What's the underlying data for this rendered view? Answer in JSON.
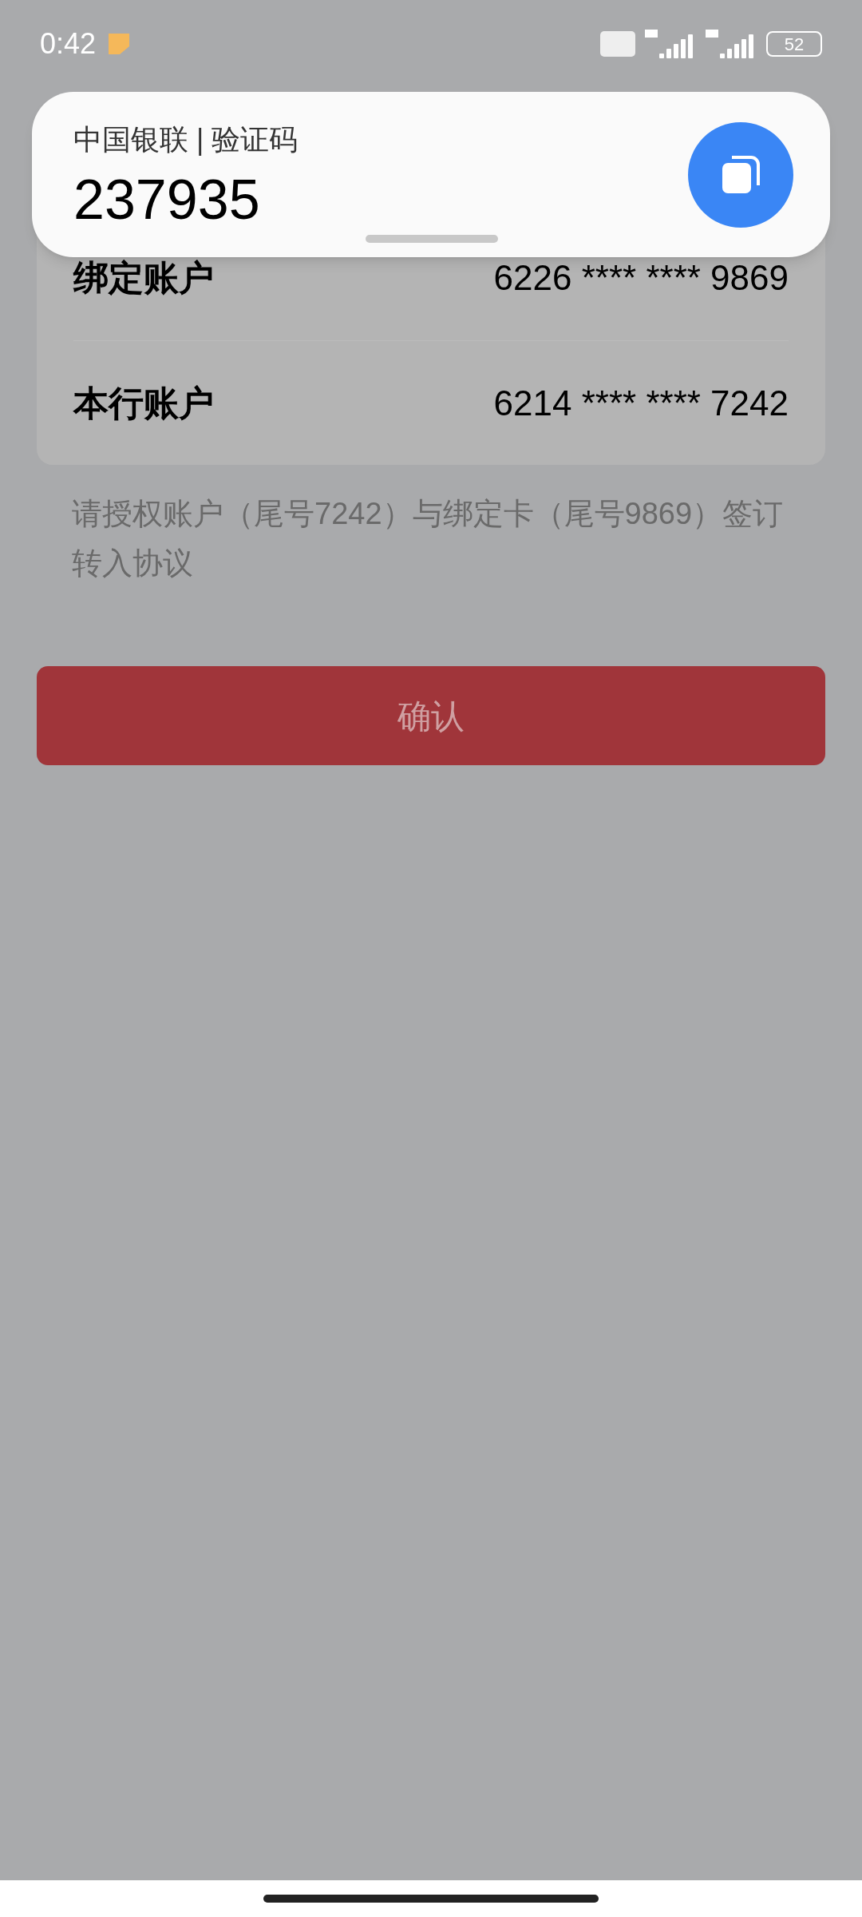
{
  "status_bar": {
    "time": "0:42",
    "battery": "52"
  },
  "accounts": [
    {
      "label": "绑定账户",
      "number": "6226 **** **** 9869"
    },
    {
      "label": "本行账户",
      "number": "6214 **** **** 7242"
    }
  ],
  "description": "请授权账户（尾号7242）与绑定卡（尾号9869）签订转入协议",
  "confirm_button": "确认",
  "notification": {
    "source": "中国银联 | 验证码",
    "code": "237935"
  }
}
